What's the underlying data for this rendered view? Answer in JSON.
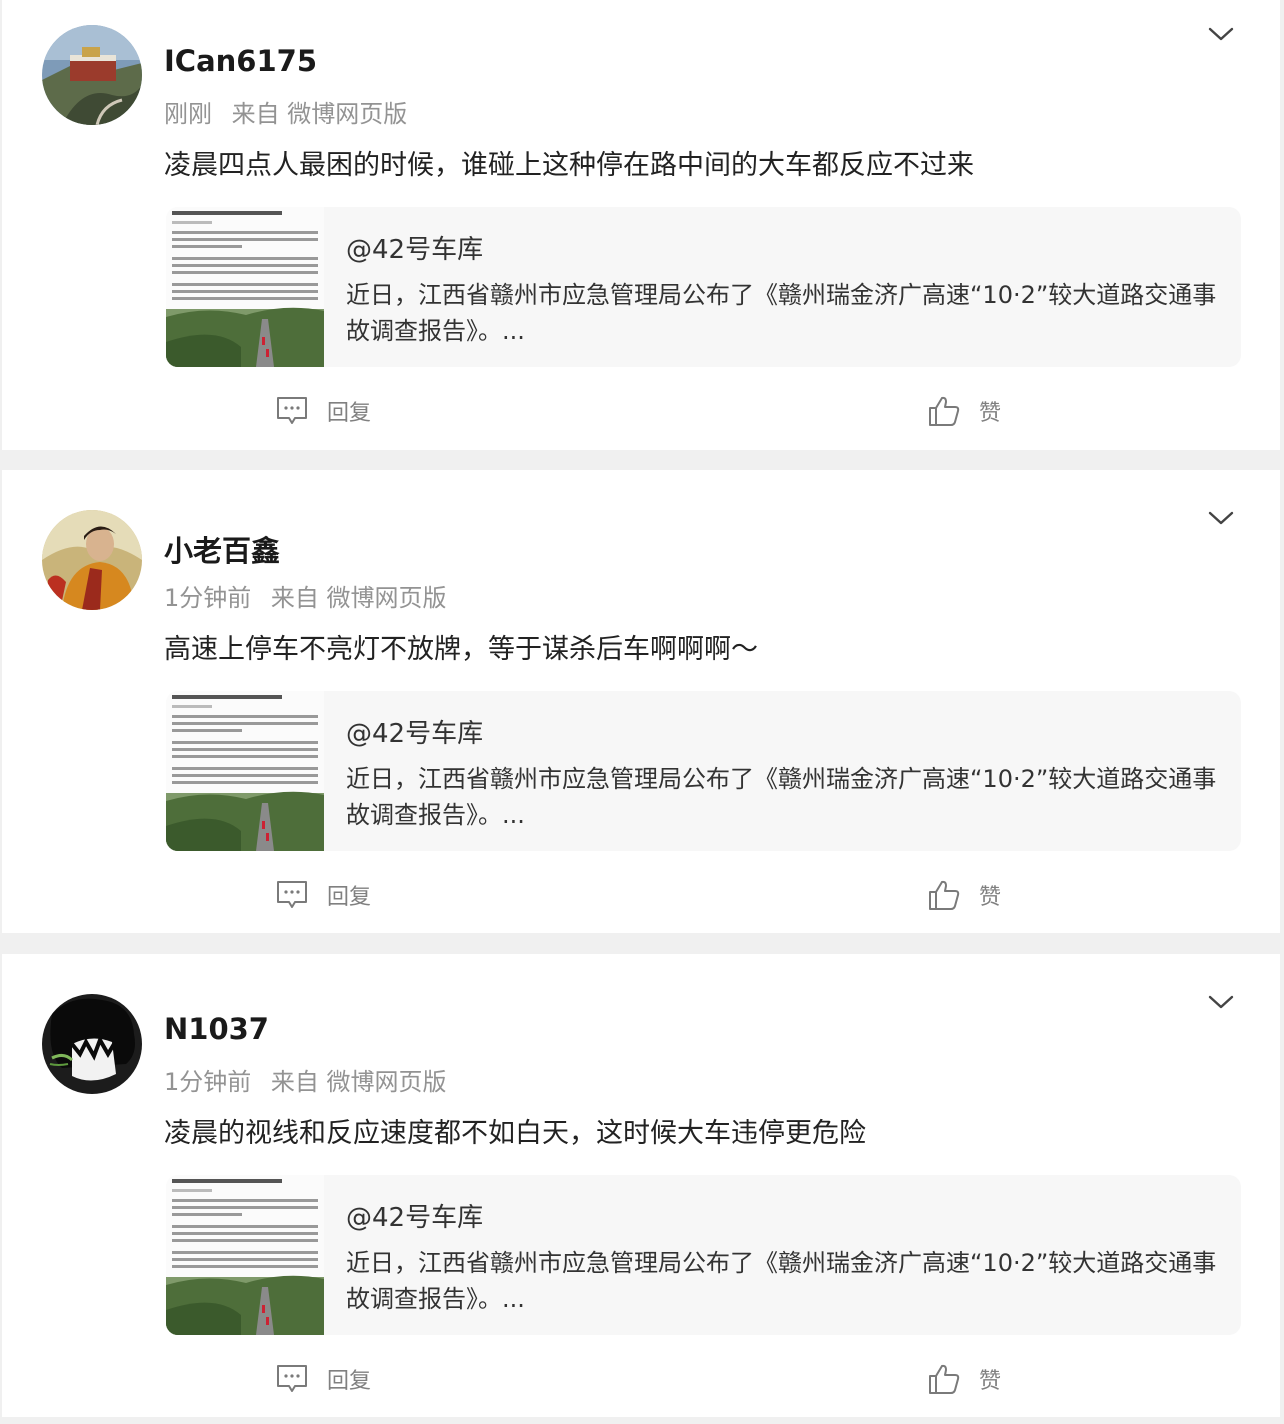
{
  "comments": [
    {
      "username": "ICan6175",
      "time": "刚刚",
      "source": "来自 微博网页版",
      "text": "凌晨四点人最困的时候，谁碰上这种停在路中间的大车都反应不过来",
      "avatar_icon": "avatar-temple-photo",
      "link": {
        "title": "@42号车库",
        "desc": "近日，江西省赣州市应急管理局公布了《赣州瑞金济广高速“10·2”较大道路交通事故调查报告》。..."
      },
      "reply_label": "回复",
      "like_label": "赞"
    },
    {
      "username": "小老百鑫",
      "time": "1分钟前",
      "source": "来自 微博网页版",
      "text": "高速上停车不亮灯不放牌，等于谋杀后车啊啊啊～",
      "avatar_icon": "avatar-person-photo",
      "link": {
        "title": "@42号车库",
        "desc": "近日，江西省赣州市应急管理局公布了《赣州瑞金济广高速“10·2”较大道路交通事故调查报告》。..."
      },
      "reply_label": "回复",
      "like_label": "赞"
    },
    {
      "username": "N1037",
      "time": "1分钟前",
      "source": "来自 微博网页版",
      "text": "凌晨的视线和反应速度都不如白天，这时候大车违停更危险",
      "avatar_icon": "avatar-anime-photo",
      "link": {
        "title": "@42号车库",
        "desc": "近日，江西省赣州市应急管理局公布了《赣州瑞金济广高速“10·2”较大道路交通事故调查报告》。..."
      },
      "reply_label": "回复",
      "like_label": "赞"
    }
  ],
  "colors": {
    "background": "#f0f0f0",
    "card": "#ffffff",
    "meta_text": "#939393",
    "link_card": "#f7f7f7",
    "action_icon": "#7a7a7a"
  }
}
